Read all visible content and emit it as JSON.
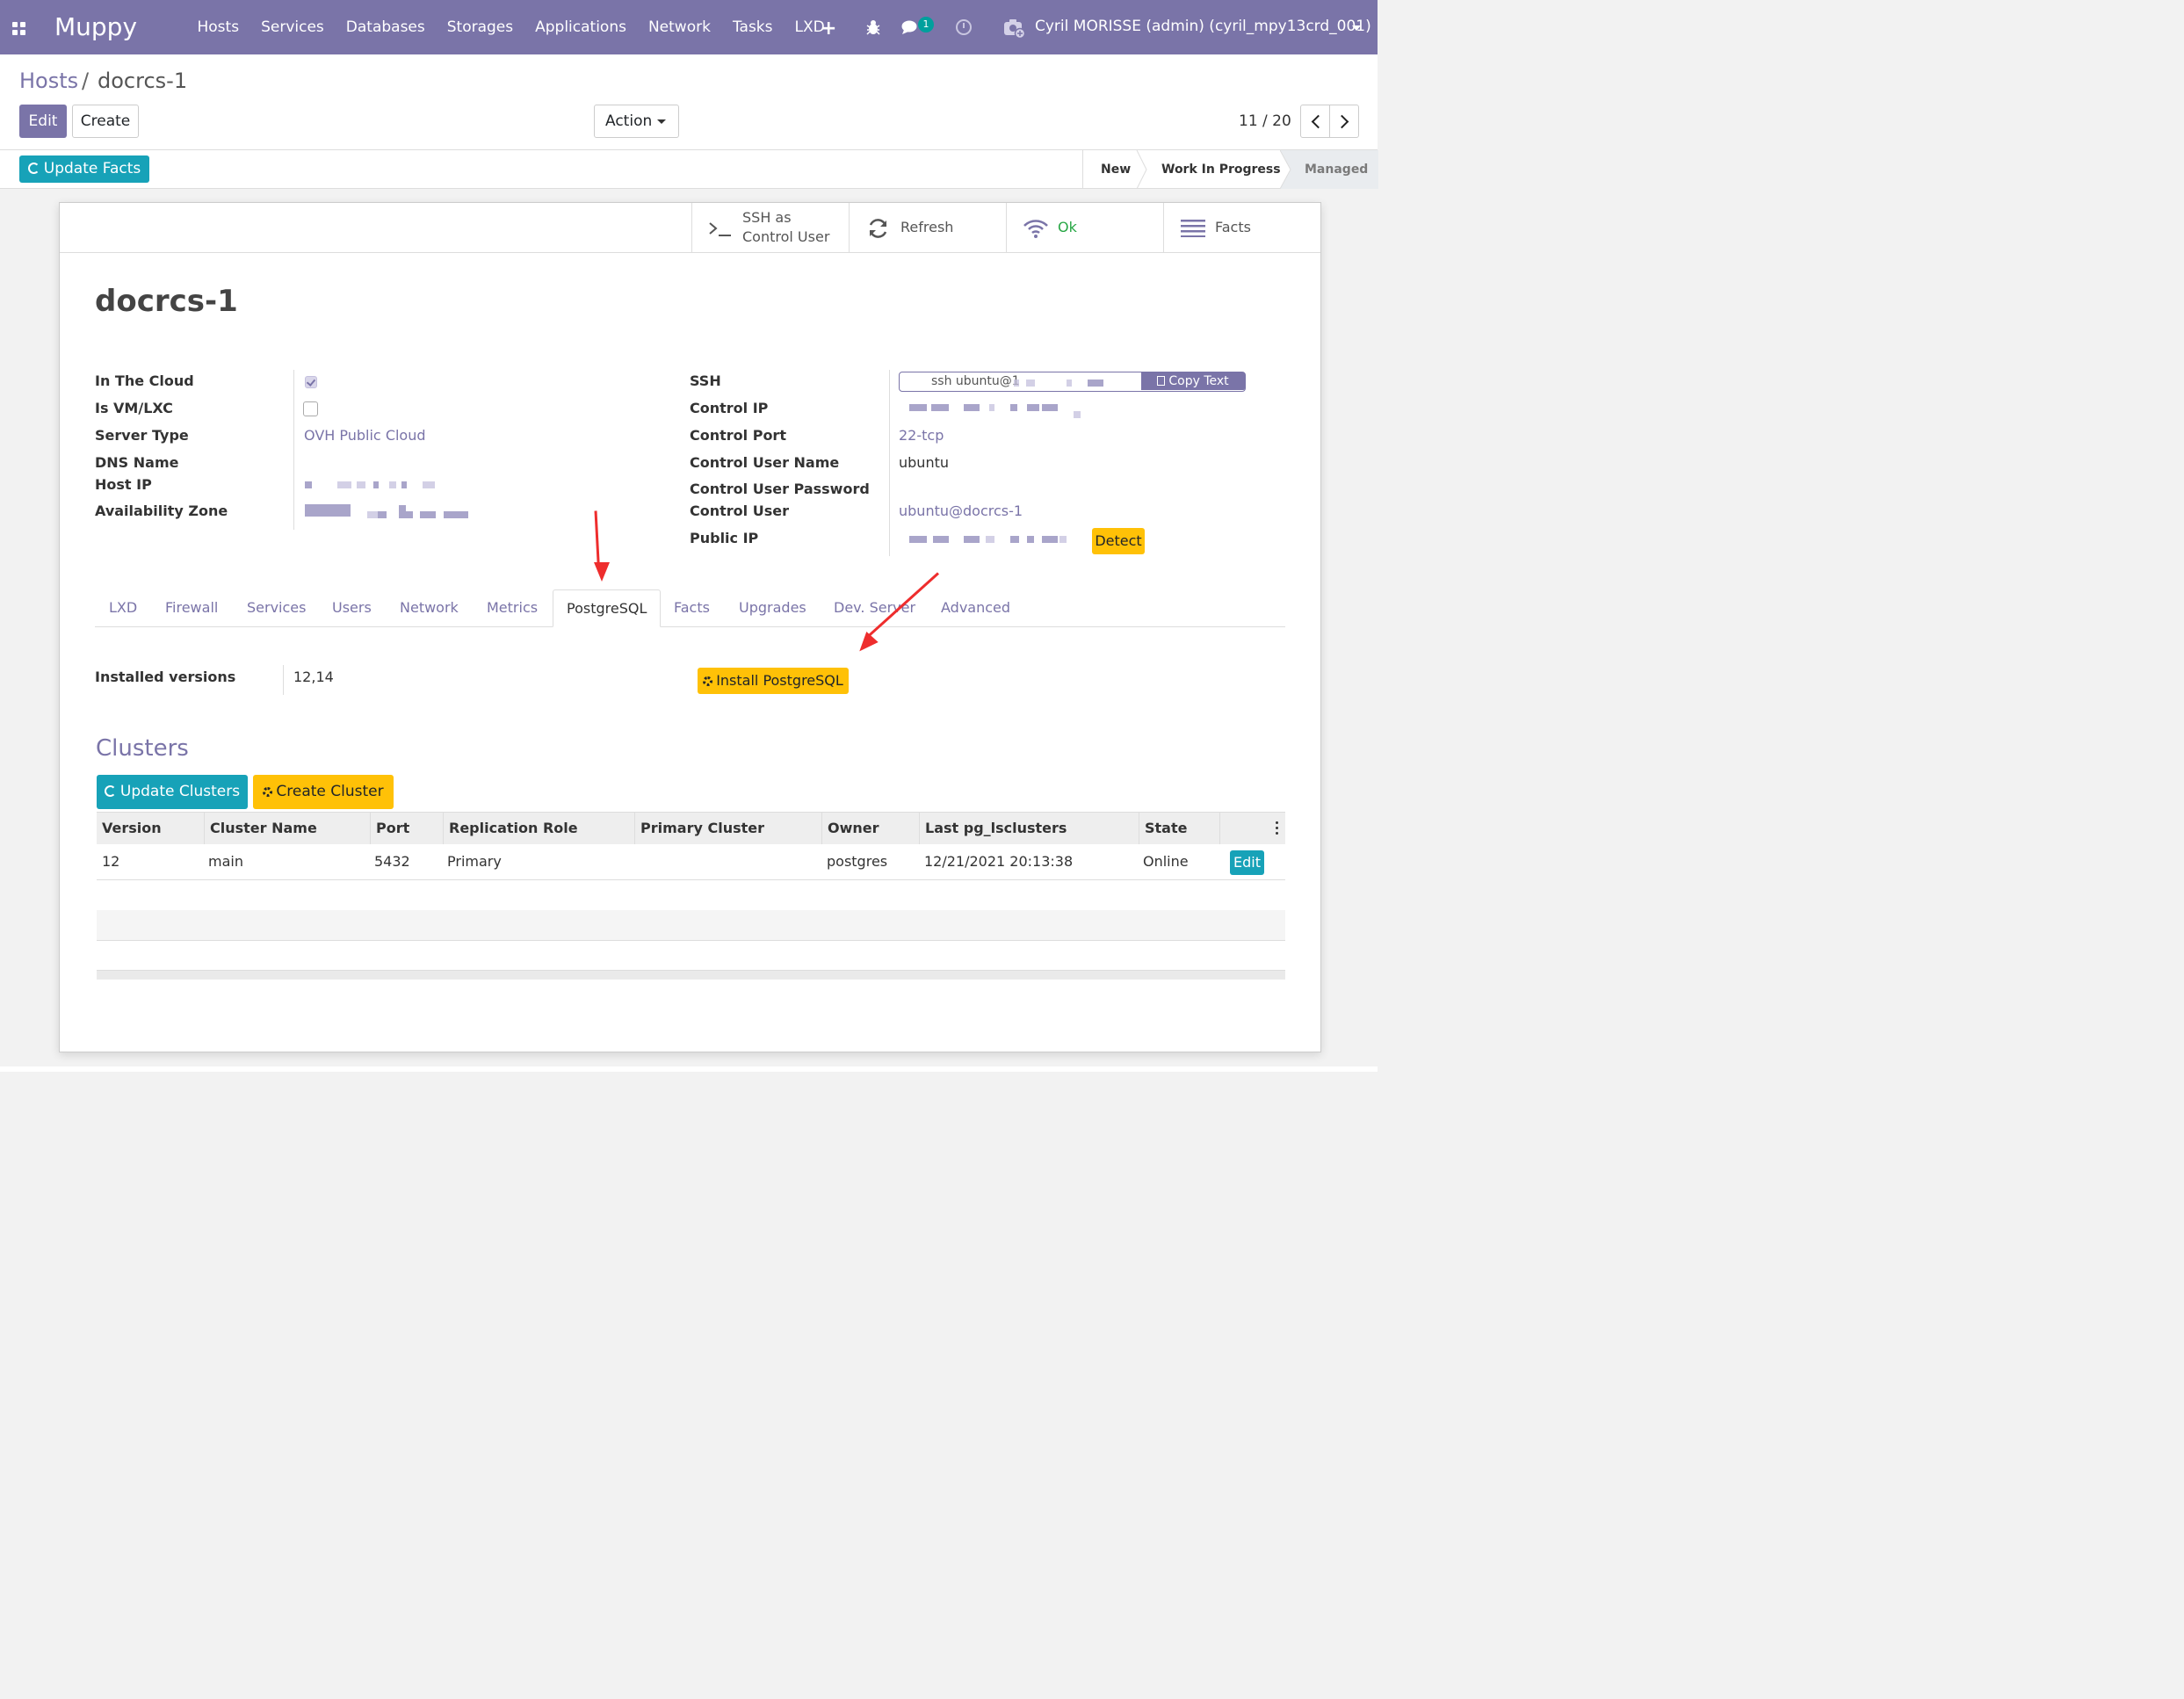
{
  "navbar": {
    "brand": "Muppy",
    "menu": [
      "Hosts",
      "Services",
      "Databases",
      "Storages",
      "Applications",
      "Network",
      "Tasks",
      "LXD"
    ],
    "chat_count": "1",
    "user": "Cyril MORISSE (admin) (cyril_mpy13crd_001)"
  },
  "breadcrumb": {
    "parent": "Hosts",
    "separator": "/",
    "current": "docrcs-1"
  },
  "buttons": {
    "edit": "Edit",
    "create": "Create",
    "action": "Action",
    "update_facts": "Update Facts"
  },
  "pager": {
    "value": "11 / 20"
  },
  "statusbar": {
    "stages": [
      "New",
      "Work In Progress",
      "Managed"
    ],
    "current": "Managed"
  },
  "smart_buttons": {
    "ssh_line1": "SSH as",
    "ssh_line2": "Control User",
    "refresh": "Refresh",
    "status": "Ok",
    "facts": "Facts"
  },
  "colors": {
    "accent": "#7a74a8",
    "info": "#17a2b8",
    "warning": "#ffc107",
    "ok": "#28a745",
    "annotation_arrow": "#ee2d2d"
  },
  "record": {
    "name": "docrcs-1",
    "left_fields": {
      "in_the_cloud": {
        "label": "In The Cloud",
        "checked": true
      },
      "is_vm": {
        "label": "Is VM/LXC",
        "checked": false
      },
      "server_type": {
        "label": "Server Type",
        "value": "OVH Public Cloud"
      },
      "dns_name": {
        "label": "DNS Name",
        "value": ""
      },
      "host_ip": {
        "label": "Host IP"
      },
      "availability_zone": {
        "label": "Availability Zone"
      }
    },
    "right_fields": {
      "ssh": {
        "label": "SSH",
        "value": "ssh ubuntu@1",
        "copy": "Copy Text"
      },
      "control_ip": {
        "label": "Control IP"
      },
      "control_port": {
        "label": "Control Port",
        "value": "22-tcp"
      },
      "control_user_name": {
        "label": "Control User Name",
        "value": "ubuntu"
      },
      "control_user_password": {
        "label": "Control User Password",
        "value": ""
      },
      "control_user": {
        "label": "Control User",
        "value": "ubuntu@docrcs-1"
      },
      "public_ip": {
        "label": "Public IP",
        "detect": "Detect"
      }
    }
  },
  "tabs": [
    "LXD",
    "Firewall",
    "Services",
    "Users",
    "Network",
    "Metrics",
    "PostgreSQL",
    "Facts",
    "Upgrades",
    "Dev. Server",
    "Advanced"
  ],
  "active_tab": "PostgreSQL",
  "postgresql": {
    "installed_label": "Installed versions",
    "installed_value": "12,14",
    "install_button": "Install PostgreSQL",
    "clusters_title": "Clusters",
    "update_clusters": "Update Clusters",
    "create_cluster": "Create Cluster",
    "columns": [
      "Version",
      "Cluster Name",
      "Port",
      "Replication Role",
      "Primary Cluster",
      "Owner",
      "Last pg_lsclusters",
      "State"
    ],
    "rows": [
      {
        "version": "12",
        "cluster_name": "main",
        "port": "5432",
        "replication_role": "Primary",
        "primary_cluster": "",
        "owner": "postgres",
        "last_lsclusters": "12/21/2021 20:13:38",
        "state": "Online",
        "edit": "Edit"
      }
    ]
  }
}
